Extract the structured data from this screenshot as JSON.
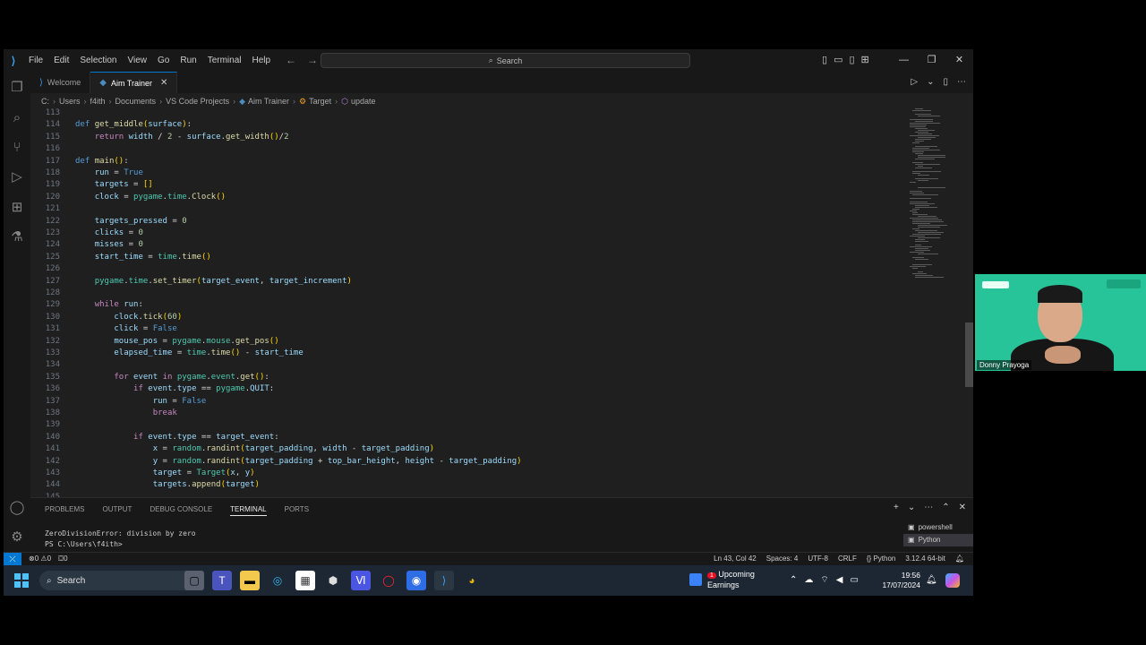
{
  "titlebar": {
    "menu": [
      "File",
      "Edit",
      "Selection",
      "View",
      "Go",
      "Run",
      "Terminal",
      "Help"
    ],
    "search_label": "Search"
  },
  "tabs": [
    {
      "label": "Welcome",
      "active": false
    },
    {
      "label": "Aim Trainer",
      "active": true
    }
  ],
  "breadcrumb": [
    "C:",
    "Users",
    "f4ith",
    "Documents",
    "VS Code Projects",
    "Aim Trainer",
    "Target",
    "update"
  ],
  "editor": {
    "lines": [
      {
        "n": "113",
        "tokens": []
      },
      {
        "n": "114",
        "tokens": [
          [
            "kw",
            "def "
          ],
          [
            "fnn",
            "get_middle"
          ],
          [
            "paren",
            "("
          ],
          [
            "var",
            "surface"
          ],
          [
            "paren",
            ")"
          ],
          [
            "",
            ":"
          ]
        ]
      },
      {
        "n": "115",
        "tokens": [
          [
            "",
            "    "
          ],
          [
            "ctl",
            "return "
          ],
          [
            "var",
            "width "
          ],
          [
            "",
            "/ "
          ],
          [
            "num",
            "2 "
          ],
          [
            "",
            "- "
          ],
          [
            "var",
            "surface"
          ],
          [
            "",
            "."
          ],
          [
            "fnn",
            "get_width"
          ],
          [
            "paren",
            "()"
          ],
          [
            "",
            "/"
          ],
          [
            "num",
            "2"
          ]
        ]
      },
      {
        "n": "116",
        "tokens": []
      },
      {
        "n": "117",
        "tokens": [
          [
            "kw",
            "def "
          ],
          [
            "fnn",
            "main"
          ],
          [
            "paren",
            "()"
          ],
          [
            "",
            ":"
          ]
        ]
      },
      {
        "n": "118",
        "tokens": [
          [
            "",
            "    "
          ],
          [
            "var",
            "run "
          ],
          [
            "",
            "= "
          ],
          [
            "kw",
            "True"
          ]
        ]
      },
      {
        "n": "119",
        "tokens": [
          [
            "",
            "    "
          ],
          [
            "var",
            "targets "
          ],
          [
            "",
            "= "
          ],
          [
            "paren",
            "[]"
          ]
        ]
      },
      {
        "n": "120",
        "tokens": [
          [
            "",
            "    "
          ],
          [
            "var",
            "clock "
          ],
          [
            "",
            "= "
          ],
          [
            "cls",
            "pygame"
          ],
          [
            "",
            "."
          ],
          [
            "cls",
            "time"
          ],
          [
            "",
            "."
          ],
          [
            "fnn",
            "Clock"
          ],
          [
            "paren",
            "()"
          ]
        ]
      },
      {
        "n": "121",
        "tokens": []
      },
      {
        "n": "122",
        "tokens": [
          [
            "",
            "    "
          ],
          [
            "var",
            "targets_pressed "
          ],
          [
            "",
            "= "
          ],
          [
            "num",
            "0"
          ]
        ]
      },
      {
        "n": "123",
        "tokens": [
          [
            "",
            "    "
          ],
          [
            "var",
            "clicks "
          ],
          [
            "",
            "= "
          ],
          [
            "num",
            "0"
          ]
        ]
      },
      {
        "n": "124",
        "tokens": [
          [
            "",
            "    "
          ],
          [
            "var",
            "misses "
          ],
          [
            "",
            "= "
          ],
          [
            "num",
            "0"
          ]
        ]
      },
      {
        "n": "125",
        "tokens": [
          [
            "",
            "    "
          ],
          [
            "var",
            "start_time "
          ],
          [
            "",
            "= "
          ],
          [
            "cls",
            "time"
          ],
          [
            "",
            "."
          ],
          [
            "fnn",
            "time"
          ],
          [
            "paren",
            "()"
          ]
        ]
      },
      {
        "n": "126",
        "tokens": []
      },
      {
        "n": "127",
        "tokens": [
          [
            "",
            "    "
          ],
          [
            "cls",
            "pygame"
          ],
          [
            "",
            "."
          ],
          [
            "cls",
            "time"
          ],
          [
            "",
            "."
          ],
          [
            "fnn",
            "set_timer"
          ],
          [
            "paren",
            "("
          ],
          [
            "var",
            "target_event"
          ],
          [
            "",
            ", "
          ],
          [
            "var",
            "target_increment"
          ],
          [
            "paren",
            ")"
          ]
        ]
      },
      {
        "n": "128",
        "tokens": []
      },
      {
        "n": "129",
        "tokens": [
          [
            "",
            "    "
          ],
          [
            "ctl",
            "while "
          ],
          [
            "var",
            "run"
          ],
          [
            "",
            ":"
          ]
        ]
      },
      {
        "n": "130",
        "tokens": [
          [
            "",
            "        "
          ],
          [
            "var",
            "clock"
          ],
          [
            "",
            "."
          ],
          [
            "fnn",
            "tick"
          ],
          [
            "paren",
            "("
          ],
          [
            "num",
            "60"
          ],
          [
            "paren",
            ")"
          ]
        ]
      },
      {
        "n": "131",
        "tokens": [
          [
            "",
            "        "
          ],
          [
            "var",
            "click "
          ],
          [
            "",
            "= "
          ],
          [
            "kw",
            "False"
          ]
        ]
      },
      {
        "n": "132",
        "tokens": [
          [
            "",
            "        "
          ],
          [
            "var",
            "mouse_pos "
          ],
          [
            "",
            "= "
          ],
          [
            "cls",
            "pygame"
          ],
          [
            "",
            "."
          ],
          [
            "cls",
            "mouse"
          ],
          [
            "",
            "."
          ],
          [
            "fnn",
            "get_pos"
          ],
          [
            "paren",
            "()"
          ]
        ]
      },
      {
        "n": "133",
        "tokens": [
          [
            "",
            "        "
          ],
          [
            "var",
            "elapsed_time "
          ],
          [
            "",
            "= "
          ],
          [
            "cls",
            "time"
          ],
          [
            "",
            "."
          ],
          [
            "fnn",
            "time"
          ],
          [
            "paren",
            "()"
          ],
          [
            "",
            " - "
          ],
          [
            "var",
            "start_time"
          ]
        ]
      },
      {
        "n": "134",
        "tokens": []
      },
      {
        "n": "135",
        "tokens": [
          [
            "",
            "        "
          ],
          [
            "ctl",
            "for "
          ],
          [
            "var",
            "event "
          ],
          [
            "ctl",
            "in "
          ],
          [
            "cls",
            "pygame"
          ],
          [
            "",
            "."
          ],
          [
            "cls",
            "event"
          ],
          [
            "",
            "."
          ],
          [
            "fnn",
            "get"
          ],
          [
            "paren",
            "()"
          ],
          [
            "",
            ":"
          ]
        ]
      },
      {
        "n": "136",
        "tokens": [
          [
            "",
            "            "
          ],
          [
            "ctl",
            "if "
          ],
          [
            "var",
            "event"
          ],
          [
            "",
            "."
          ],
          [
            "var",
            "type "
          ],
          [
            "",
            "== "
          ],
          [
            "cls",
            "pygame"
          ],
          [
            "",
            "."
          ],
          [
            "var",
            "QUIT"
          ],
          [
            "",
            ":"
          ]
        ]
      },
      {
        "n": "137",
        "tokens": [
          [
            "",
            "                "
          ],
          [
            "var",
            "run "
          ],
          [
            "",
            "= "
          ],
          [
            "kw",
            "False"
          ]
        ]
      },
      {
        "n": "138",
        "tokens": [
          [
            "",
            "                "
          ],
          [
            "ctl",
            "break"
          ]
        ]
      },
      {
        "n": "139",
        "tokens": []
      },
      {
        "n": "140",
        "tokens": [
          [
            "",
            "            "
          ],
          [
            "ctl",
            "if "
          ],
          [
            "var",
            "event"
          ],
          [
            "",
            "."
          ],
          [
            "var",
            "type "
          ],
          [
            "",
            "== "
          ],
          [
            "var",
            "target_event"
          ],
          [
            "",
            ":"
          ]
        ]
      },
      {
        "n": "141",
        "tokens": [
          [
            "",
            "                "
          ],
          [
            "var",
            "x "
          ],
          [
            "",
            "= "
          ],
          [
            "cls",
            "random"
          ],
          [
            "",
            "."
          ],
          [
            "fnn",
            "randint"
          ],
          [
            "paren",
            "("
          ],
          [
            "var",
            "target_padding"
          ],
          [
            "",
            ", "
          ],
          [
            "var",
            "width "
          ],
          [
            "",
            "- "
          ],
          [
            "var",
            "target_padding"
          ],
          [
            "paren",
            ")"
          ]
        ]
      },
      {
        "n": "142",
        "tokens": [
          [
            "",
            "                "
          ],
          [
            "var",
            "y "
          ],
          [
            "",
            "= "
          ],
          [
            "cls",
            "random"
          ],
          [
            "",
            "."
          ],
          [
            "fnn",
            "randint"
          ],
          [
            "paren",
            "("
          ],
          [
            "var",
            "target_padding "
          ],
          [
            "",
            "+ "
          ],
          [
            "var",
            "top_bar_height"
          ],
          [
            "",
            ", "
          ],
          [
            "var",
            "height "
          ],
          [
            "",
            "- "
          ],
          [
            "var",
            "target_padding"
          ],
          [
            "paren",
            ")"
          ]
        ]
      },
      {
        "n": "143",
        "tokens": [
          [
            "",
            "                "
          ],
          [
            "var",
            "target "
          ],
          [
            "",
            "= "
          ],
          [
            "cls",
            "Target"
          ],
          [
            "paren",
            "("
          ],
          [
            "var",
            "x"
          ],
          [
            "",
            ", "
          ],
          [
            "var",
            "y"
          ],
          [
            "paren",
            ")"
          ]
        ]
      },
      {
        "n": "144",
        "tokens": [
          [
            "",
            "                "
          ],
          [
            "var",
            "targets"
          ],
          [
            "",
            "."
          ],
          [
            "fnn",
            "append"
          ],
          [
            "paren",
            "("
          ],
          [
            "var",
            "target"
          ],
          [
            "paren",
            ")"
          ]
        ]
      },
      {
        "n": "145",
        "tokens": []
      }
    ]
  },
  "panel": {
    "tabs": [
      "PROBLEMS",
      "OUTPUT",
      "DEBUG CONSOLE",
      "TERMINAL",
      "PORTS"
    ],
    "active_tab": "TERMINAL",
    "terminal_lines": [
      "ZeroDivisionError: division by zero",
      "PS C:\\Users\\f4ith>"
    ],
    "shells": [
      {
        "label": "powershell",
        "active": false
      },
      {
        "label": "Python",
        "active": true
      }
    ]
  },
  "statusbar": {
    "errors": "0",
    "warnings": "0",
    "ports": "0",
    "position": "Ln 43, Col 42",
    "spaces": "Spaces: 4",
    "encoding": "UTF-8",
    "eol": "CRLF",
    "language": "Python",
    "interpreter": "3.12.4 64-bit"
  },
  "taskbar": {
    "search_label": "Search",
    "news_title": "Upcoming",
    "news_sub": "Earnings",
    "news_badge": "1",
    "time": "19:56",
    "date": "17/07/2024"
  },
  "webcam": {
    "name": "Donny Prayoga"
  },
  "colors": {
    "accent": "#0078d4",
    "editor_bg": "#1f1f1f",
    "webcam_bg": "#27c49a"
  }
}
